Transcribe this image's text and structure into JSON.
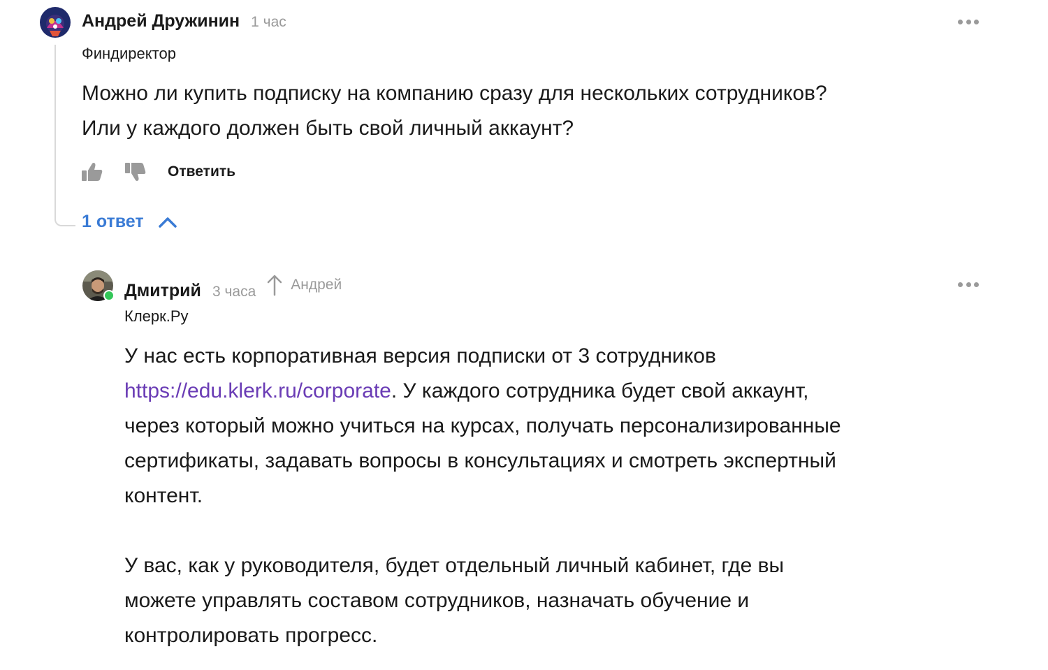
{
  "comment": {
    "author": "Андрей Дружинин",
    "time": "1 час",
    "role": "Финдиректор",
    "text_lines": [
      "Можно ли купить подписку на компанию сразу для нескольких сотрудников?",
      "Или у каждого должен быть свой личный аккаунт?"
    ],
    "actions": {
      "like_icon": "thumbs-up-icon",
      "dislike_icon": "thumbs-down-icon",
      "reply_label": "Ответить"
    },
    "answers_toggle": "1 ответ",
    "more_icon": "more-dots-icon"
  },
  "reply": {
    "author": "Дмитрий",
    "time": "3 часа",
    "reply_to": "Андрей",
    "role": "Клерк.Ру",
    "online": true,
    "paragraph1": {
      "line1": "У нас есть корпоративная версия подписки от 3 сотрудников",
      "link": "https://edu.klerk.ru/corporate",
      "after_link": ". У каждого сотрудника будет свой аккаунт,",
      "line3": "через который можно учиться на курсах, получать персонализированные",
      "line4": "сертификаты, задавать вопросы в консультациях и смотреть экспертный",
      "line5": "контент."
    },
    "paragraph2": {
      "line1": "У вас, как у руководителя, будет отдельный личный кабинет, где вы",
      "line2": "можете управлять составом сотрудников, назначать обучение и",
      "line3": "контролировать прогресс."
    },
    "more_icon": "more-dots-icon"
  },
  "colors": {
    "link": "#6a3cb5",
    "answers_toggle": "#3a7bd5",
    "muted": "#9a9a9a",
    "online": "#34c759"
  }
}
